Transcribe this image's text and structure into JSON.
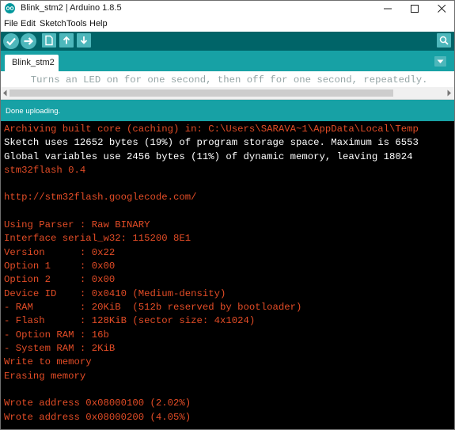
{
  "window": {
    "title": "Blink_stm2 | Arduino 1.8.5",
    "controls": [
      "minimize-icon",
      "maximize-icon",
      "close-icon"
    ]
  },
  "menu": {
    "items": [
      "File",
      "Edit",
      "Sketch",
      "Tools",
      "Help"
    ]
  },
  "toolbar": {
    "buttons": [
      "verify-icon",
      "upload-icon",
      "new-icon",
      "open-icon",
      "save-icon"
    ],
    "right_button": "serial-monitor-icon"
  },
  "tabs": {
    "active": "Blink_stm2",
    "menu_icon": "tab-dropdown-icon"
  },
  "editor": {
    "visible_line": "  Turns an LED on for one second, then off for one second, repeatedly."
  },
  "status": {
    "message": "Done uploading."
  },
  "console": {
    "lines": [
      {
        "text": "Archiving built core (caching) in: C:\\Users\\SARAVA~1\\AppData\\Local\\Temp",
        "color": "#e34c26"
      },
      {
        "text": "Sketch uses 12652 bytes (19%) of program storage space. Maximum is 6553",
        "color": "#ffffff"
      },
      {
        "text": "Global variables use 2456 bytes (11%) of dynamic memory, leaving 18024",
        "color": "#ffffff"
      },
      {
        "text": "stm32flash 0.4",
        "color": "#e34c26"
      },
      {
        "text": "",
        "color": "#e34c26"
      },
      {
        "text": "http://stm32flash.googlecode.com/",
        "color": "#e34c26"
      },
      {
        "text": "",
        "color": "#e34c26"
      },
      {
        "text": "Using Parser : Raw BINARY",
        "color": "#e34c26"
      },
      {
        "text": "Interface serial_w32: 115200 8E1",
        "color": "#e34c26"
      },
      {
        "text": "Version      : 0x22",
        "color": "#e34c26"
      },
      {
        "text": "Option 1     : 0x00",
        "color": "#e34c26"
      },
      {
        "text": "Option 2     : 0x00",
        "color": "#e34c26"
      },
      {
        "text": "Device ID    : 0x0410 (Medium-density)",
        "color": "#e34c26"
      },
      {
        "text": "- RAM        : 20KiB  (512b reserved by bootloader)",
        "color": "#e34c26"
      },
      {
        "text": "- Flash      : 128KiB (sector size: 4x1024)",
        "color": "#e34c26"
      },
      {
        "text": "- Option RAM : 16b",
        "color": "#e34c26"
      },
      {
        "text": "- System RAM : 2KiB",
        "color": "#e34c26"
      },
      {
        "text": "Write to memory",
        "color": "#e34c26"
      },
      {
        "text": "Erasing memory",
        "color": "#e34c26"
      },
      {
        "text": "",
        "color": "#e34c26"
      },
      {
        "text": "Wrote address 0x08000100 (2.02%)",
        "color": "#e34c26"
      },
      {
        "text": "Wrote address 0x08000200 (4.05%)",
        "color": "#e34c26"
      }
    ]
  },
  "colors": {
    "toolbar_bg": "#006468",
    "accent": "#17a1a5",
    "button": "#4db7bb",
    "console_bg": "#000000",
    "console_red": "#e34c26"
  }
}
